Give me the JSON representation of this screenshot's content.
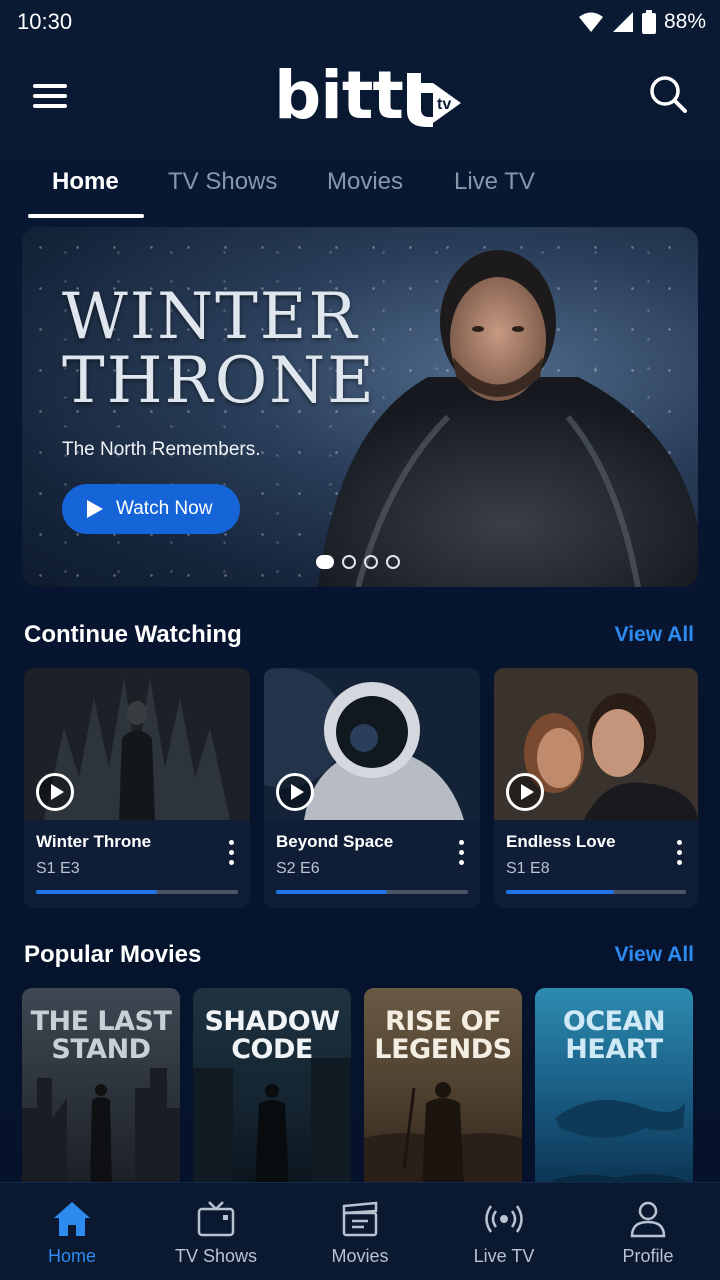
{
  "status_bar": {
    "time": "10:30",
    "battery": "88%"
  },
  "header": {
    "logo_text": "bitt",
    "logo_suffix": "tv"
  },
  "tabs": [
    {
      "label": "Home",
      "active": true
    },
    {
      "label": "TV Shows",
      "active": false
    },
    {
      "label": "Movies",
      "active": false
    },
    {
      "label": "Live TV",
      "active": false
    }
  ],
  "hero": {
    "title_line1": "WINTER",
    "title_line2": "THRONE",
    "tagline": "The North Remembers.",
    "button_label": "Watch Now",
    "slide_count": 4,
    "active_slide": 1
  },
  "continue_watching": {
    "title": "Continue Watching",
    "view_all": "View All",
    "items": [
      {
        "title": "Winter Throne",
        "episode": "S1 E3",
        "progress": 0.6
      },
      {
        "title": "Beyond Space",
        "episode": "S2 E6",
        "progress": 0.58
      },
      {
        "title": "Endless Love",
        "episode": "S1 E8",
        "progress": 0.6
      }
    ]
  },
  "popular_movies": {
    "title": "Popular Movies",
    "view_all": "View All",
    "items": [
      {
        "line1": "THE LAST",
        "line2": "STAND"
      },
      {
        "line1": "SHADOW",
        "line2": "CODE"
      },
      {
        "line1": "RISE OF",
        "line2": "LEGENDS"
      },
      {
        "line1": "OCEAN",
        "line2": "HEART"
      }
    ]
  },
  "bottom_nav": [
    {
      "label": "Home",
      "icon": "home-icon",
      "active": true
    },
    {
      "label": "TV Shows",
      "icon": "tv-icon",
      "active": false
    },
    {
      "label": "Movies",
      "icon": "clapperboard-icon",
      "active": false
    },
    {
      "label": "Live TV",
      "icon": "broadcast-icon",
      "active": false
    },
    {
      "label": "Profile",
      "icon": "profile-icon",
      "active": false
    }
  ],
  "colors": {
    "accent": "#2d8bf0",
    "button": "#1565d8",
    "background": "#071530"
  }
}
